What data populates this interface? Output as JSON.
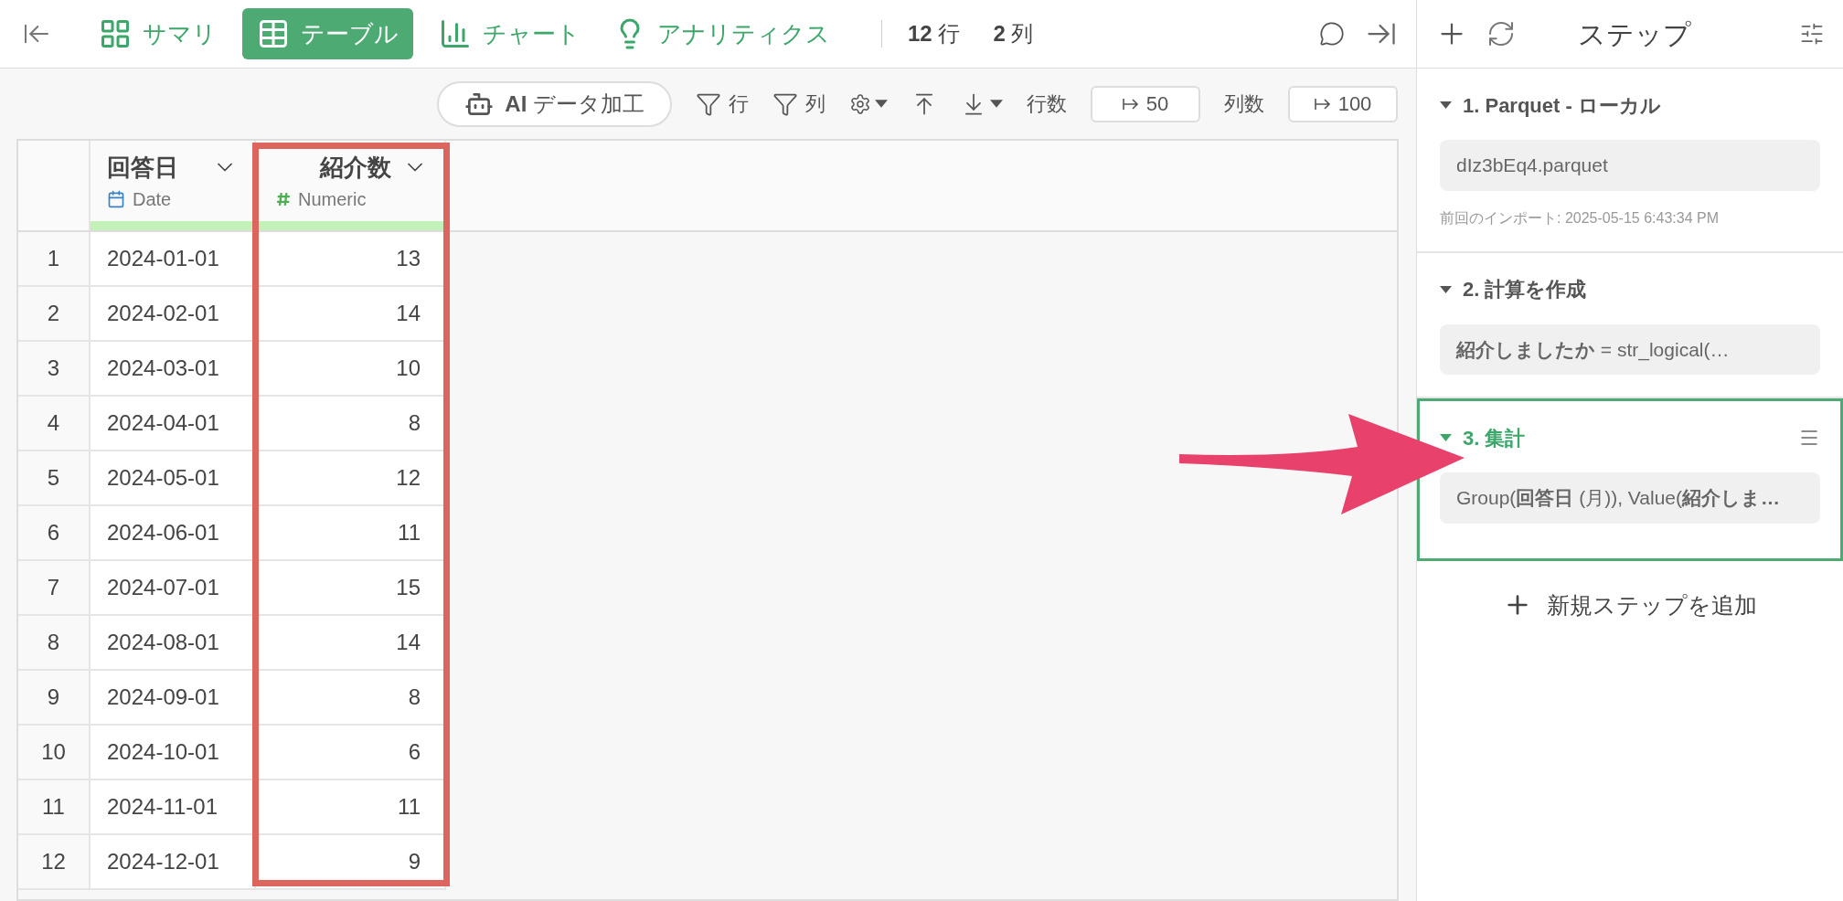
{
  "nav": {
    "tabs": [
      {
        "label": "サマリ",
        "selected": false
      },
      {
        "label": "テーブル",
        "selected": true
      },
      {
        "label": "チャート",
        "selected": false
      },
      {
        "label": "アナリティクス",
        "selected": false
      }
    ],
    "counts": [
      {
        "value": "12",
        "unit": "行"
      },
      {
        "value": "2",
        "unit": "列"
      }
    ]
  },
  "toolbar": {
    "ai_button": "**AI** データ加工",
    "filters": [
      "行",
      "列"
    ],
    "rows_label": "行数",
    "rows_value": "50",
    "cols_label": "列数",
    "cols_value": "100"
  },
  "table": {
    "columns": [
      {
        "name": "回答日",
        "type": "Date",
        "highlighted": false
      },
      {
        "name": "紹介数",
        "type": "Numeric",
        "highlighted": true
      }
    ],
    "rows": [
      {
        "index": "1",
        "cells": [
          "2024-01-01",
          "13"
        ]
      },
      {
        "index": "2",
        "cells": [
          "2024-02-01",
          "14"
        ]
      },
      {
        "index": "3",
        "cells": [
          "2024-03-01",
          "10"
        ]
      },
      {
        "index": "4",
        "cells": [
          "2024-04-01",
          "8"
        ]
      },
      {
        "index": "5",
        "cells": [
          "2024-05-01",
          "12"
        ]
      },
      {
        "index": "6",
        "cells": [
          "2024-06-01",
          "11"
        ]
      },
      {
        "index": "7",
        "cells": [
          "2024-07-01",
          "15"
        ]
      },
      {
        "index": "8",
        "cells": [
          "2024-08-01",
          "14"
        ]
      },
      {
        "index": "9",
        "cells": [
          "2024-09-01",
          "8"
        ]
      },
      {
        "index": "10",
        "cells": [
          "2024-10-01",
          "6"
        ]
      },
      {
        "index": "11",
        "cells": [
          "2024-11-01",
          "11"
        ]
      },
      {
        "index": "12",
        "cells": [
          "2024-12-01",
          "9"
        ]
      }
    ]
  },
  "steps_panel": {
    "title": "ステップ",
    "steps": [
      {
        "title": "1. Parquet - ローカル",
        "summary": "dIz3bEq4.parquet",
        "note": "前回のインポート: 2025-05-15 6:43:34 PM",
        "selected": false
      },
      {
        "title": "2. 計算を作成",
        "summary": "**紹介しましたか** = str_logical(…",
        "selected": false
      },
      {
        "title": "3. 集計",
        "summary": "Group(**回答日** (月)), Value(**紹介しま…**",
        "selected": true
      }
    ],
    "add_step": "新規ステップを追加"
  }
}
